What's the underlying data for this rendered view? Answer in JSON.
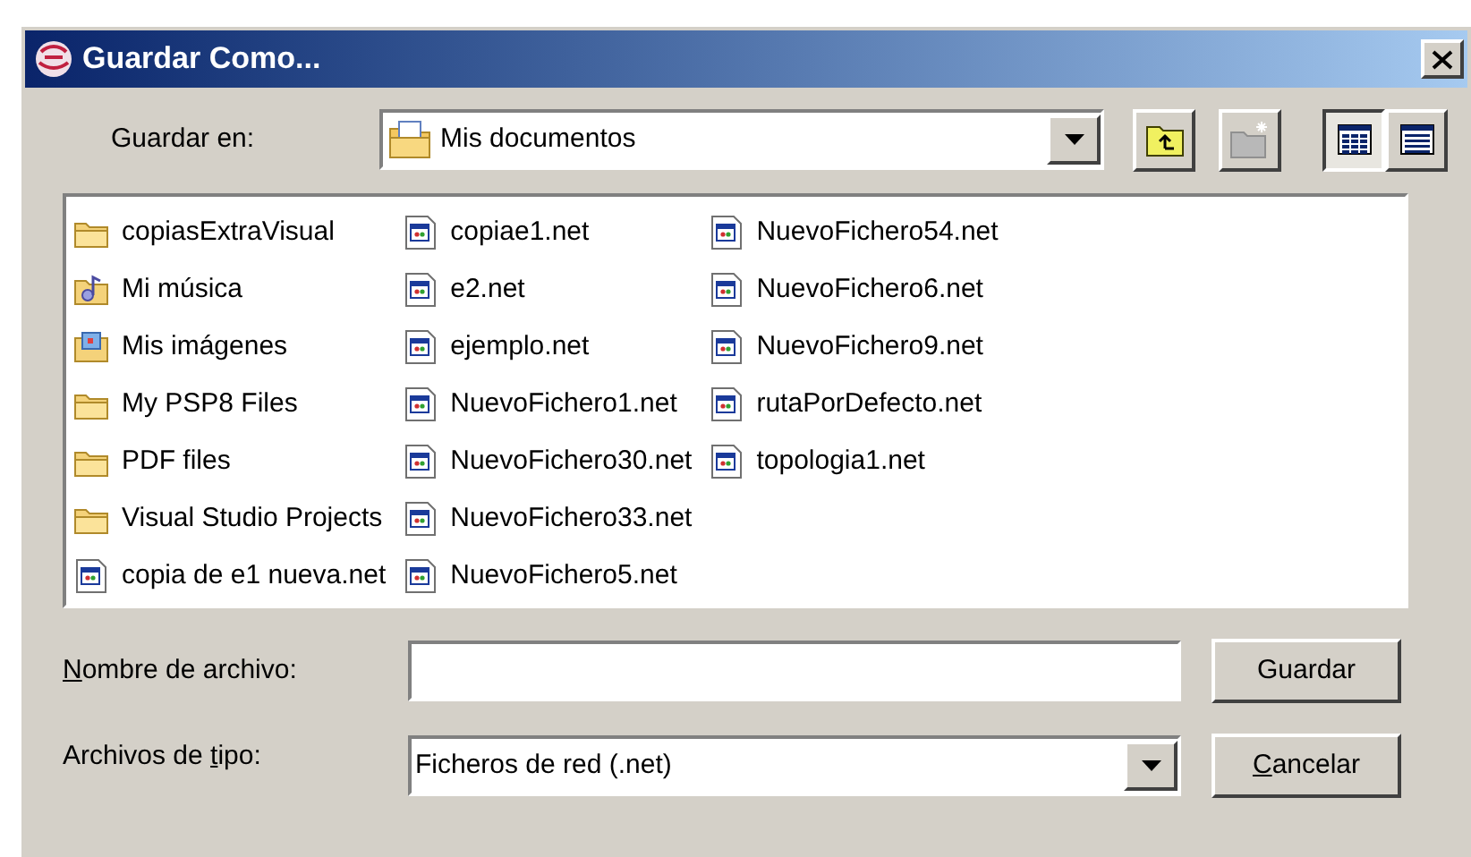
{
  "window": {
    "title": "Guardar Como..."
  },
  "look_in": {
    "label": "Guardar en:",
    "value": "Mis documentos"
  },
  "toolbar": [
    {
      "kind": "up",
      "disabled": false
    },
    {
      "kind": "new-folder",
      "disabled": true
    },
    {
      "kind": "list-view",
      "selected": true
    },
    {
      "kind": "details-view",
      "selected": false
    }
  ],
  "files": [
    [
      {
        "name": "copiasExtraVisual",
        "kind": "folder"
      },
      {
        "name": "Mi música",
        "kind": "music"
      },
      {
        "name": "Mis imágenes",
        "kind": "pictures"
      },
      {
        "name": "My PSP8 Files",
        "kind": "folder"
      },
      {
        "name": "PDF files",
        "kind": "folder"
      },
      {
        "name": "Visual Studio Projects",
        "kind": "folder"
      },
      {
        "name": "copia de e1 nueva.net",
        "kind": "file"
      }
    ],
    [
      {
        "name": "copiae1.net",
        "kind": "file"
      },
      {
        "name": "e2.net",
        "kind": "file"
      },
      {
        "name": "ejemplo.net",
        "kind": "file"
      },
      {
        "name": "NuevoFichero1.net",
        "kind": "file"
      },
      {
        "name": "NuevoFichero30.net",
        "kind": "file"
      },
      {
        "name": "NuevoFichero33.net",
        "kind": "file"
      },
      {
        "name": "NuevoFichero5.net",
        "kind": "file"
      }
    ],
    [
      {
        "name": "NuevoFichero54.net",
        "kind": "file"
      },
      {
        "name": "NuevoFichero6.net",
        "kind": "file"
      },
      {
        "name": "NuevoFichero9.net",
        "kind": "file"
      },
      {
        "name": "rutaPorDefecto.net",
        "kind": "file"
      },
      {
        "name": "topologia1.net",
        "kind": "file"
      }
    ]
  ],
  "file_name": {
    "label": [
      {
        "text": "N",
        "underlined": true
      },
      {
        "text": "ombre de archivo:",
        "underlined": false
      }
    ]
  },
  "file_type": {
    "label": [
      {
        "text": "Archivos de ",
        "underlined": false
      },
      {
        "text": "t",
        "underlined": true
      },
      {
        "text": "ipo:",
        "underlined": false
      }
    ],
    "value": "Ficheros de red (.net)"
  },
  "buttons": [
    {
      "label": [
        {
          "text": "Guardar",
          "underlined": false
        }
      ]
    },
    {
      "label": [
        {
          "text": "C",
          "underlined": true
        },
        {
          "text": "ancelar",
          "underlined": false
        }
      ]
    }
  ]
}
